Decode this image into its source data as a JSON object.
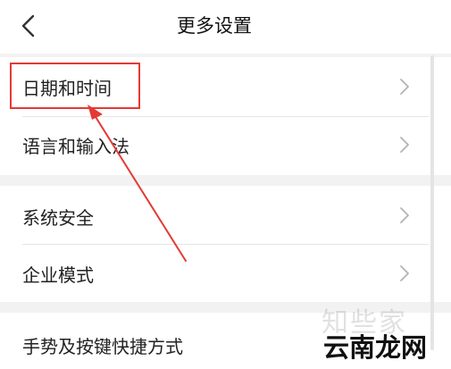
{
  "header": {
    "back_icon": "chevron-left-icon",
    "title": "更多设置"
  },
  "groups": [
    {
      "items": [
        {
          "label": "日期和时间",
          "icon": "chevron-right-icon"
        },
        {
          "label": "语言和输入法",
          "icon": "chevron-right-icon"
        }
      ]
    },
    {
      "items": [
        {
          "label": "系统安全",
          "icon": "chevron-right-icon"
        },
        {
          "label": "企业模式",
          "icon": "chevron-right-icon"
        }
      ]
    },
    {
      "items": [
        {
          "label": "手势及按键快捷方式"
        }
      ]
    }
  ],
  "annotation": {
    "highlight_color": "#e53935",
    "arrow_color": "#e53935"
  },
  "watermark": {
    "faint_text": "知些家",
    "text": "云南龙网"
  },
  "colors": {
    "background": "#f2f2f2",
    "card": "#ffffff",
    "text": "#222222",
    "chevron": "#b3b3b3"
  }
}
